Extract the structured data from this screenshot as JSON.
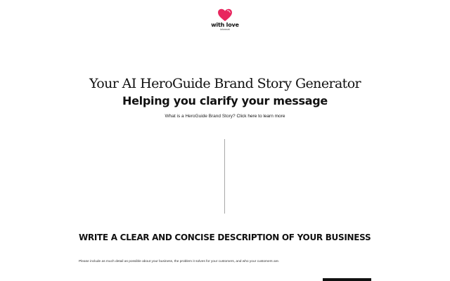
{
  "brand": {
    "name": "with love",
    "sub": "internet",
    "heart_color": "#e8265e"
  },
  "hero": {
    "title": "Your AI HeroGuide Brand Story Generator",
    "subtitle": "Helping you clarify your message",
    "question": "What is a HeroGuide Brand Story?",
    "link_label": "Click here to learn more"
  },
  "form": {
    "heading": "WRITE A CLEAR AND CONCISE DESCRIPTION OF YOUR BUSINESS",
    "help_text": "Please include as much detail as possible about your business, the problem it solves for your customers, and who your customers are."
  }
}
